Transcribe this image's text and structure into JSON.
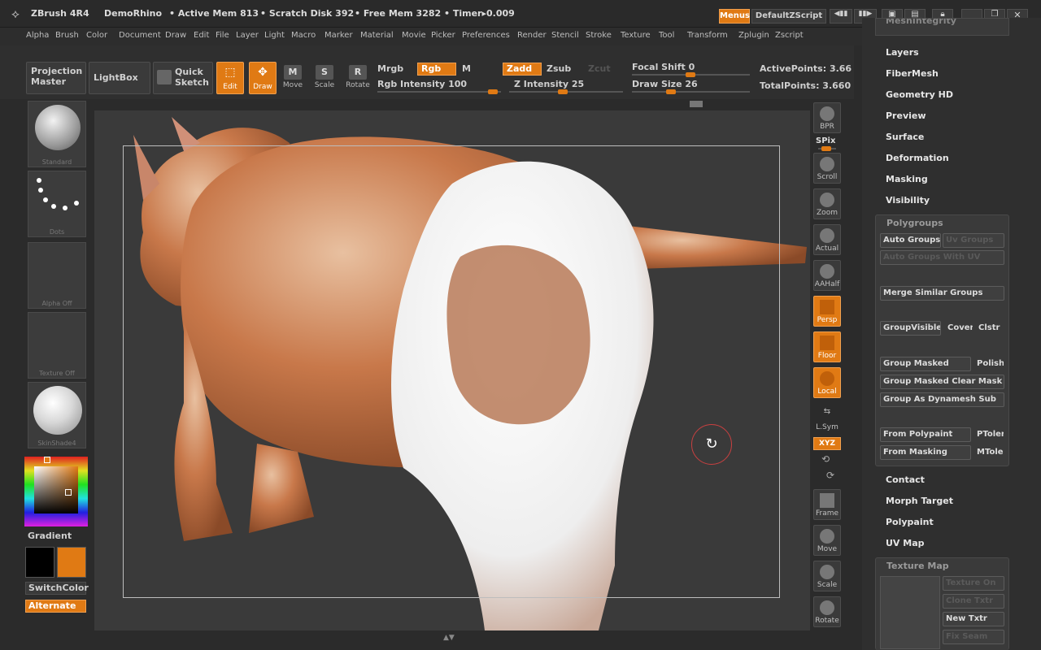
{
  "title_bar": {
    "app": "ZBrush 4R4",
    "document": "DemoRhino",
    "active_mem": "• Active Mem 813",
    "scratch_disk": "• Scratch Disk 392",
    "free_mem": "• Free Mem 3282",
    "timer": "• Timer▸0.009",
    "menus_button": "Menus",
    "script_button": "DefaultZScript"
  },
  "menu_bar": [
    "Alpha",
    "Brush",
    "Color",
    "Document",
    "Draw",
    "Edit",
    "File",
    "Layer",
    "Light",
    "Macro",
    "Marker",
    "Material",
    "Movie",
    "Picker",
    "Preferences",
    "Render",
    "Stencil",
    "Stroke",
    "Texture",
    "Tool",
    "Transform",
    "Zplugin",
    "Zscript"
  ],
  "toolbar": {
    "projection_master": "Projection Master",
    "lightbox": "LightBox",
    "quick_sketch": "Quick Sketch",
    "edit": "Edit",
    "draw": "Draw",
    "move": "Move",
    "scale": "Scale",
    "rotate": "Rotate",
    "mrgb": "Mrgb",
    "rgb": "Rgb",
    "m": "M",
    "zadd": "Zadd",
    "zsub": "Zsub",
    "zcut": "Zcut",
    "rgb_intensity": "Rgb Intensity 100",
    "z_intensity": "Z Intensity 25",
    "focal_shift": "Focal Shift 0",
    "draw_size": "Draw Size 26",
    "active_points": "ActivePoints: 3.66",
    "total_points": "TotalPoints: 3.660"
  },
  "left_shelf": {
    "brush": "Standard",
    "stroke": "Dots",
    "alpha": "Alpha Off",
    "texture": "Texture Off",
    "material": "SkinShade4",
    "gradient": "Gradient",
    "switch_color": "SwitchColor",
    "alternate": "Alternate",
    "colors": {
      "main": "#000000",
      "secondary": "#e07a14"
    }
  },
  "right_shelf": [
    "BPR",
    "SPix",
    "Scroll",
    "Zoom",
    "Actual",
    "AAHalf",
    "Persp",
    "Floor",
    "Local",
    "L.Sym",
    "XYZ",
    "Frame",
    "Move",
    "Scale",
    "Rotate"
  ],
  "tool_panel": {
    "top_partial": "MeshIntegrity",
    "items_top": [
      "Layers",
      "FiberMesh",
      "Geometry HD",
      "Preview",
      "Surface",
      "Deformation",
      "Masking",
      "Visibility"
    ],
    "polygroups": {
      "header": "Polygroups",
      "auto_groups": "Auto Groups",
      "uv_groups": "Uv Groups",
      "auto_groups_uv": "Auto Groups With UV",
      "merge_similar": "Merge Similar Groups",
      "group_visible": "GroupVisible",
      "cover": "Cover",
      "clstr": "Clstr",
      "group_masked": "Group Masked",
      "polish": "Polish",
      "group_masked_clear": "Group Masked Clear Mask",
      "group_dynamesh": "Group As Dynamesh Sub",
      "from_polypaint": "From Polypaint",
      "ptoler": "PToler",
      "from_masking": "From Masking",
      "mtoler": "MToler"
    },
    "items_bottom": [
      "Contact",
      "Morph Target",
      "Polypaint",
      "UV Map"
    ],
    "texture_map": {
      "header": "Texture Map",
      "texture_on": "Texture On",
      "clone_txtr": "Clone Txtr",
      "new_txtr": "New Txtr",
      "fix_seam": "Fix Seam"
    }
  },
  "accent_color": "#e07a14"
}
